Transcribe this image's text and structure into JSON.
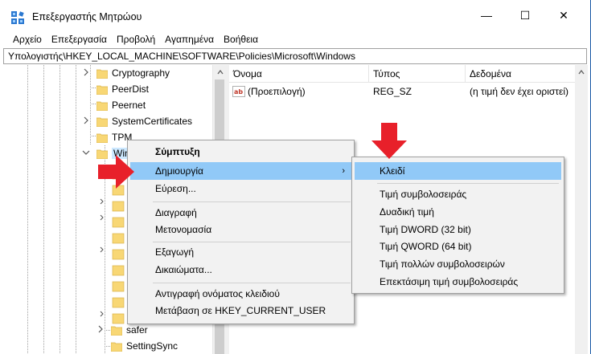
{
  "window": {
    "title": "Επεξεργαστής Μητρώου",
    "minimize_glyph": "—",
    "maximize_glyph": "☐",
    "close_glyph": "✕"
  },
  "menu": [
    "Αρχείο",
    "Επεξεργασία",
    "Προβολή",
    "Αγαπημένα",
    "Βοήθεια"
  ],
  "address": "Υπολογιστής\\HKEY_LOCAL_MACHINE\\SOFTWARE\\Policies\\Microsoft\\Windows",
  "tree": {
    "items": [
      {
        "label": "Cryptography",
        "expandable": true
      },
      {
        "label": "PeerDist",
        "expandable": false
      },
      {
        "label": "Peernet",
        "expandable": false
      },
      {
        "label": "SystemCertificates",
        "expandable": true
      },
      {
        "label": "TPM",
        "expandable": false
      },
      {
        "label": "Windows",
        "expandable": true,
        "expanded": true,
        "selected": true
      },
      {
        "label": "safer",
        "expandable": true
      },
      {
        "label": "SettingSync",
        "expandable": false
      }
    ]
  },
  "list": {
    "columns": {
      "name": "Όνομα",
      "type": "Τύπος",
      "data": "Δεδομένα"
    },
    "rows": [
      {
        "name": "(Προεπιλογή)",
        "type": "REG_SZ",
        "data": "(η τιμή δεν έχει οριστεί)"
      }
    ]
  },
  "context_menu": {
    "collapse": "Σύμπτυξη",
    "new": "Δημιουργία",
    "find": "Εύρεση...",
    "delete": "Διαγραφή",
    "rename": "Μετονομασία",
    "export": "Εξαγωγή",
    "permissions": "Δικαιώματα...",
    "copy_key_name": "Αντιγραφή ονόματος κλειδιού",
    "goto_hkcu": "Μετάβαση σε HKEY_CURRENT_USER",
    "submenu_arrow": "›"
  },
  "new_submenu": {
    "key": "Κλειδί",
    "string_value": "Τιμή συμβολοσειράς",
    "binary_value": "Δυαδική τιμή",
    "dword_value": "Τιμή DWORD (32 bit)",
    "qword_value": "Τιμή QWORD (64 bit)",
    "multi_string_value": "Τιμή πολλών συμβολοσειρών",
    "expandable_string_value": "Επεκτάσιμη τιμή συμβολοσειράς"
  },
  "colors": {
    "highlight": "#91c9f7",
    "selected_tree": "#cce8ff",
    "menu_bg": "#f2f2f2",
    "arrow_red": "#e8202a",
    "folder_yellow": "#f8d775"
  }
}
